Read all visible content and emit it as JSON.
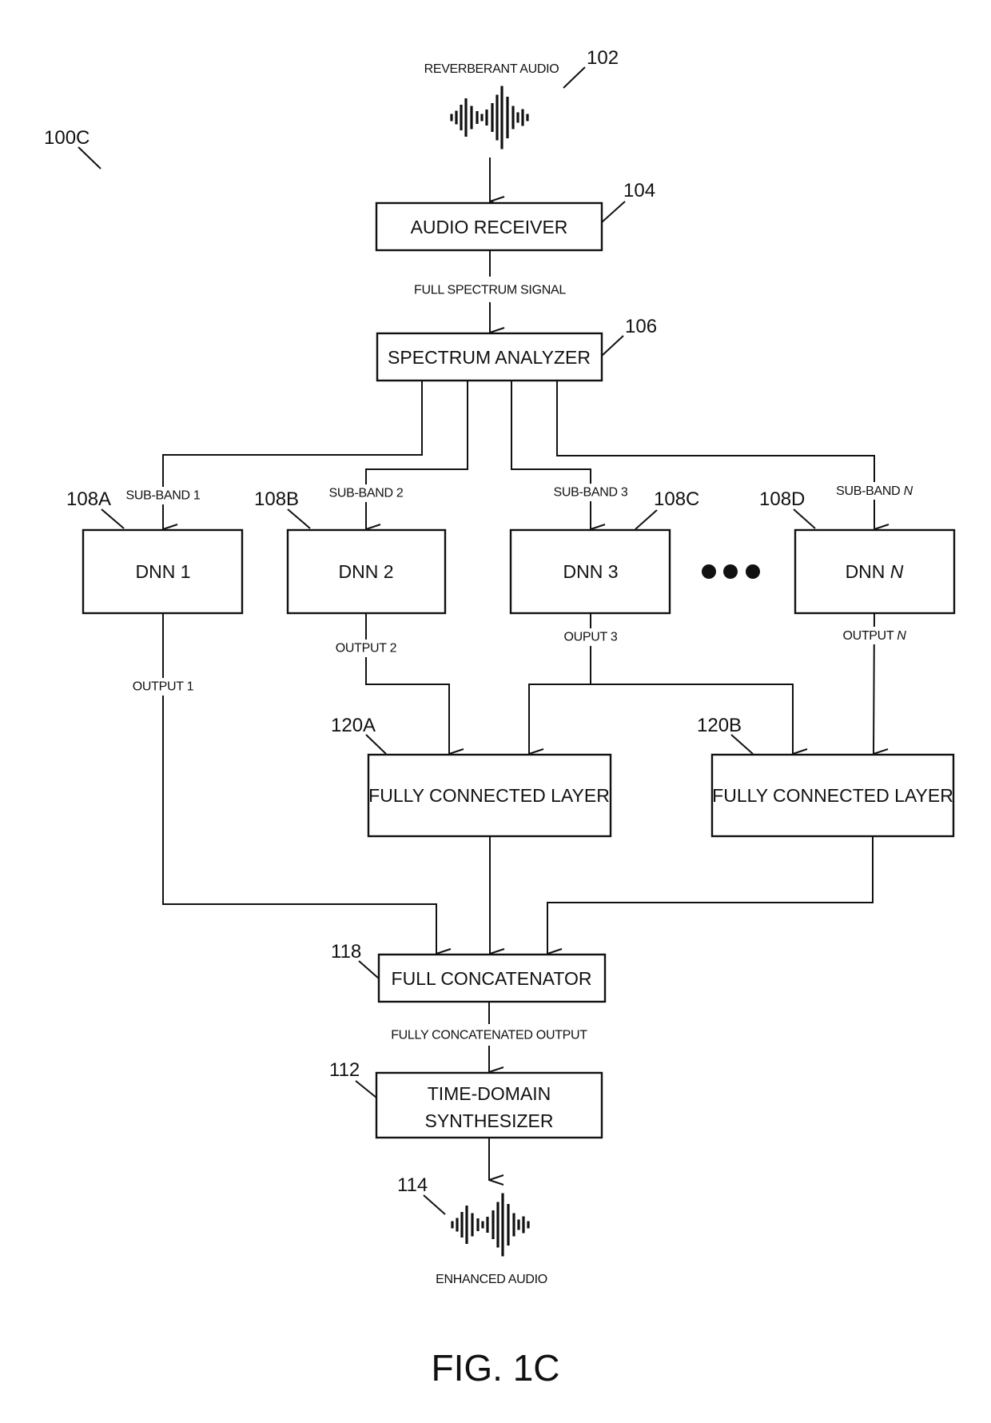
{
  "figure": {
    "id_label": "100C",
    "caption": "FIG. 1C"
  },
  "input": {
    "label": "REVERBERANT AUDIO",
    "ref": "102",
    "icon": "audio-waveform-icon"
  },
  "output": {
    "label": "ENHANCED AUDIO",
    "ref": "114",
    "icon": "audio-waveform-icon"
  },
  "blocks": {
    "audio_receiver": {
      "label": "AUDIO RECEIVER",
      "ref": "104"
    },
    "spectrum_analyzer": {
      "label": "SPECTRUM ANALYZER",
      "ref": "106"
    },
    "fcl_a": {
      "label": "FULLY CONNECTED LAYER",
      "ref": "120A"
    },
    "fcl_b": {
      "label": "FULLY CONNECTED LAYER",
      "ref": "120B"
    },
    "full_concatenator": {
      "label": "FULL CONCATENATOR",
      "ref": "118"
    },
    "synthesizer": {
      "label_line1": "TIME-DOMAIN",
      "label_line2": "SYNTHESIZER",
      "ref": "112"
    }
  },
  "dnns": [
    {
      "label": "DNN 1",
      "ref": "108A",
      "input": "SUB-BAND 1",
      "output": "OUTPUT 1"
    },
    {
      "label": "DNN 2",
      "ref": "108B",
      "input": "SUB-BAND 2",
      "output": "OUTPUT 2"
    },
    {
      "label": "DNN 3",
      "ref": "108C",
      "input": "SUB-BAND 3",
      "output": "OUPUT 3"
    },
    {
      "label_prefix": "DNN ",
      "label_var": "N",
      "ref": "108D",
      "input_prefix": "SUB-BAND ",
      "input_var": "N",
      "output_prefix": "OUTPUT ",
      "output_var": "N"
    }
  ],
  "flows": {
    "full_spectrum": "FULL SPECTRUM SIGNAL",
    "concatenated": "FULLY CONCATENATED OUTPUT"
  },
  "ellipsis": "more-dnns-ellipsis",
  "colors": {
    "ink": "#111111",
    "paper": "#ffffff"
  }
}
